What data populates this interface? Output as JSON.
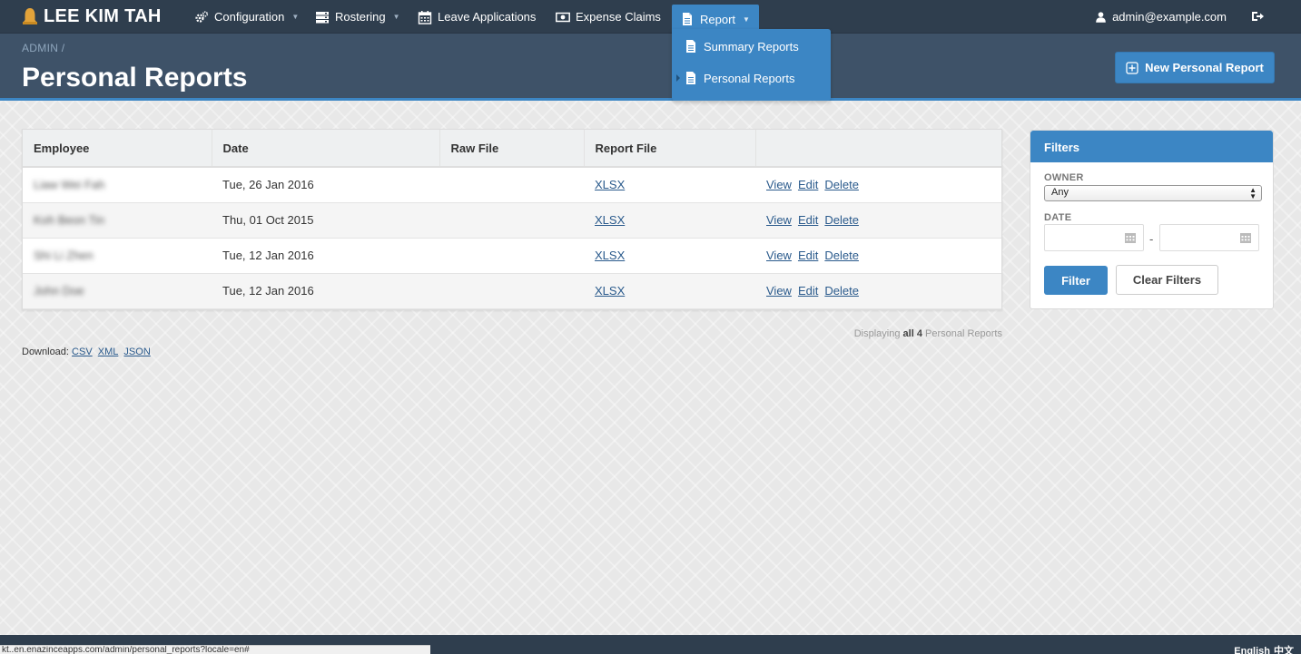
{
  "app": {
    "brand": "LEE KIM TAH"
  },
  "nav": {
    "items": [
      {
        "label": "Configuration",
        "icon": "cogs-icon",
        "dropdown": true
      },
      {
        "label": "Rostering",
        "icon": "server-icon",
        "dropdown": true
      },
      {
        "label": "Leave Applications",
        "icon": "calendar-icon",
        "dropdown": false
      },
      {
        "label": "Expense Claims",
        "icon": "money-icon",
        "dropdown": false
      },
      {
        "label": "Report",
        "icon": "file-icon",
        "dropdown": true,
        "active": true
      }
    ],
    "user": "admin@example.com"
  },
  "report_menu": {
    "items": [
      {
        "label": "Summary Reports"
      },
      {
        "label": "Personal Reports"
      }
    ]
  },
  "header": {
    "breadcrumb": "ADMIN /",
    "title": "Personal Reports",
    "new_button": "New Personal Report"
  },
  "table": {
    "headers": [
      "Employee",
      "Date",
      "Raw File",
      "Report File",
      ""
    ],
    "rows": [
      {
        "employee": "Liaw Wei Fah",
        "date": "Tue, 26 Jan 2016",
        "raw": "",
        "report": "XLSX"
      },
      {
        "employee": "Koh Beon Tin",
        "date": "Thu, 01 Oct 2015",
        "raw": "",
        "report": "XLSX"
      },
      {
        "employee": "Shi Li Zhen",
        "date": "Tue, 12 Jan 2016",
        "raw": "",
        "report": "XLSX"
      },
      {
        "employee": "John Doe",
        "date": "Tue, 12 Jan 2016",
        "raw": "",
        "report": "XLSX"
      }
    ],
    "actions": {
      "view": "View",
      "edit": "Edit",
      "delete": "Delete"
    }
  },
  "pagination": {
    "prefix": "Displaying",
    "count": "all 4",
    "suffix": "Personal Reports"
  },
  "download": {
    "label": "Download:",
    "csv": "CSV",
    "xml": "XML",
    "json": "JSON"
  },
  "filters": {
    "title": "Filters",
    "owner_label": "OWNER",
    "owner_value": "Any",
    "date_label": "DATE",
    "date_separator": "-",
    "filter_button": "Filter",
    "clear_button": "Clear Filters"
  },
  "footer": {
    "lang_en": "English",
    "lang_zh": "中文",
    "status_url": "kt..en.enazinceapps.com/admin/personal_reports?locale=en#"
  },
  "colors": {
    "navbar": "#2f3e4e",
    "header": "#3e5268",
    "accent": "#3c86c4"
  }
}
